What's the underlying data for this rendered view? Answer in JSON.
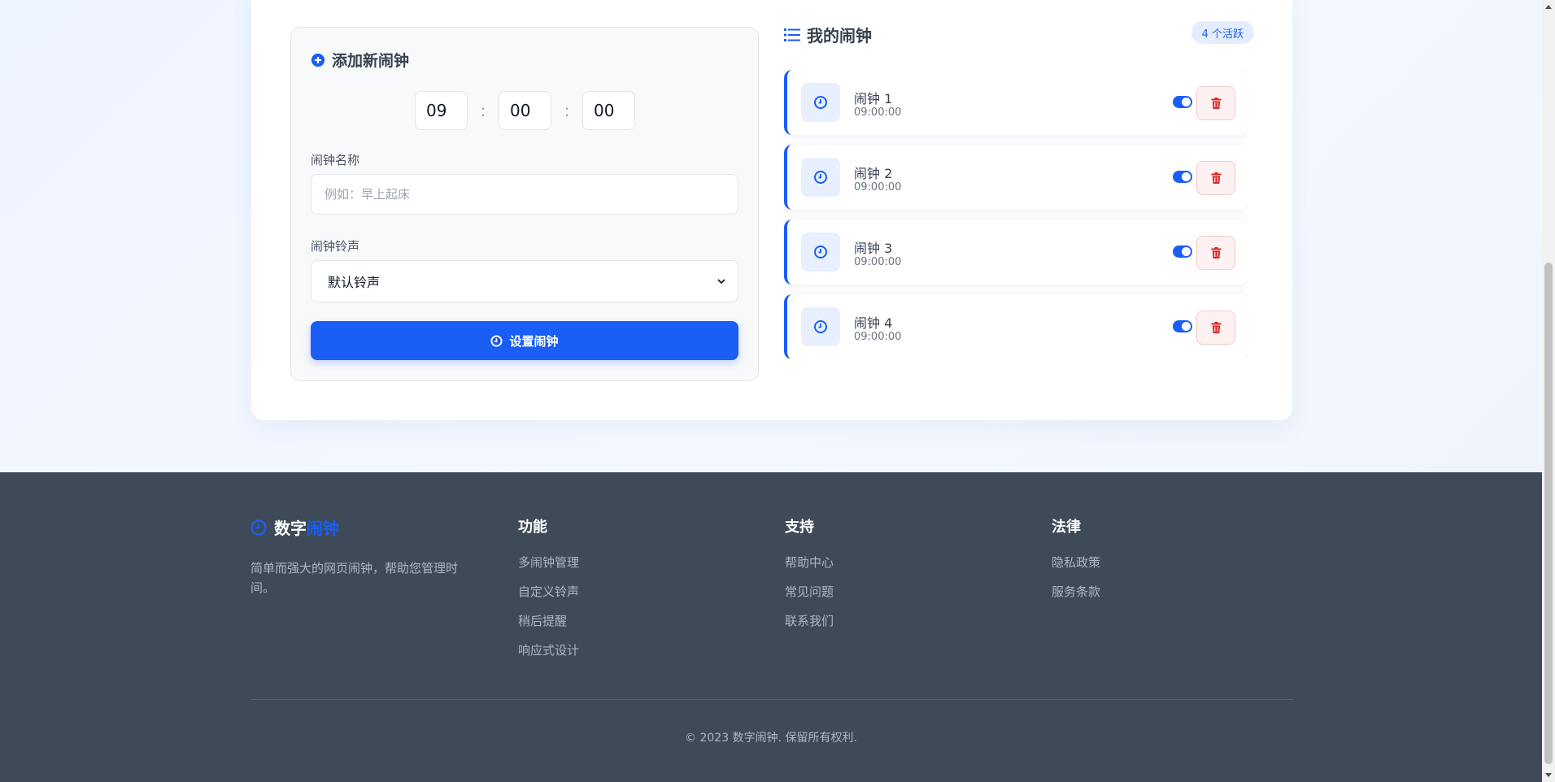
{
  "add_panel": {
    "title": "添加新闹钟",
    "hour": "09",
    "minute": "00",
    "second": "00",
    "separator": ":",
    "name_label": "闹钟名称",
    "name_placeholder": "例如：早上起床",
    "sound_label": "闹钟铃声",
    "sound_selected": "默认铃声",
    "submit_label": "设置闹钟"
  },
  "alarm_list": {
    "title": "我的闹钟",
    "active_badge": "4 个活跃",
    "items": [
      {
        "name": "闹钟 1",
        "time": "09:00:00",
        "enabled": true
      },
      {
        "name": "闹钟 2",
        "time": "09:00:00",
        "enabled": true
      },
      {
        "name": "闹钟 3",
        "time": "09:00:00",
        "enabled": true
      },
      {
        "name": "闹钟 4",
        "time": "09:00:00",
        "enabled": true
      }
    ]
  },
  "footer": {
    "brand_main": "数字",
    "brand_accent": "闹钟",
    "description": "简单而强大的网页闹钟，帮助您管理时间。",
    "columns": [
      {
        "title": "功能",
        "links": [
          "多闹钟管理",
          "自定义铃声",
          "稍后提醒",
          "响应式设计"
        ]
      },
      {
        "title": "支持",
        "links": [
          "帮助中心",
          "常见问题",
          "联系我们"
        ]
      },
      {
        "title": "法律",
        "links": [
          "隐私政策",
          "服务条款"
        ]
      }
    ],
    "copyright": "© 2023 数字闹钟. 保留所有权利."
  },
  "colors": {
    "accent": "#1a5ef5",
    "footer_bg": "#3e4a57",
    "danger": "#dc2626"
  },
  "icons": {
    "add_title": "plus-circle-icon",
    "list_title": "list-icon",
    "alarm": "clock-icon",
    "delete": "trash-icon",
    "submit": "clock-icon",
    "brand": "clock-icon"
  }
}
